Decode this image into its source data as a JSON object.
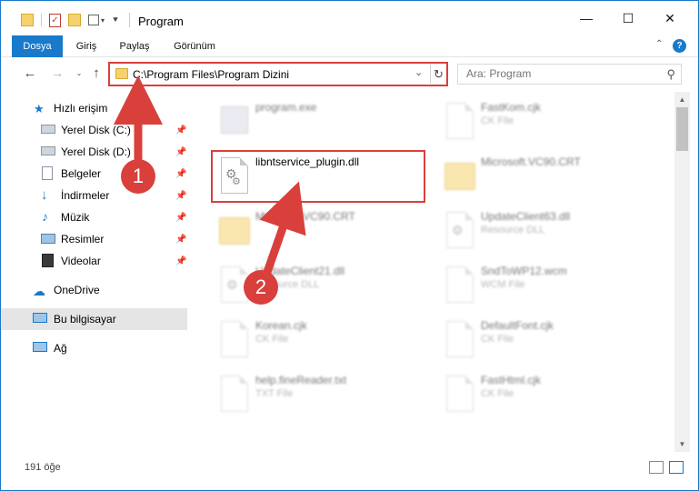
{
  "window": {
    "title": "Program",
    "minimize": "—",
    "maximize": "☐",
    "close": "✕"
  },
  "ribbon": {
    "tabs": [
      "Dosya",
      "Giriş",
      "Paylaş",
      "Görünüm"
    ],
    "collapse_icon": "chevron-up",
    "help": "?"
  },
  "address": {
    "path": "C:\\Program Files\\Program Dizini",
    "search_placeholder": "Ara: Program"
  },
  "nav": {
    "items": [
      {
        "label": "Hızlı erişim",
        "icon": "star-icon",
        "pinned": false
      },
      {
        "label": "Yerel Disk (C:)",
        "icon": "drive-icon",
        "pinned": true
      },
      {
        "label": "Yerel Disk (D:)",
        "icon": "drive-icon",
        "pinned": true
      },
      {
        "label": "Belgeler",
        "icon": "document-icon",
        "pinned": true
      },
      {
        "label": "İndirmeler",
        "icon": "download-icon",
        "pinned": true
      },
      {
        "label": "Müzik",
        "icon": "music-icon",
        "pinned": true
      },
      {
        "label": "Resimler",
        "icon": "pictures-icon",
        "pinned": true
      },
      {
        "label": "Videolar",
        "icon": "video-icon",
        "pinned": true
      },
      {
        "label": "OneDrive",
        "icon": "cloud-icon",
        "pinned": false
      },
      {
        "label": "Bu bilgisayar",
        "icon": "computer-icon",
        "pinned": false
      },
      {
        "label": "Ağ",
        "icon": "network-icon",
        "pinned": false
      }
    ]
  },
  "files": [
    {
      "name": "program.exe",
      "type": "",
      "icon": "exe"
    },
    {
      "name": "FastKom.cjk",
      "type": "CK File",
      "icon": "doc"
    },
    {
      "name": "libntservice_plugin.dll",
      "type": "",
      "icon": "dll"
    },
    {
      "name": "Microsoft.VC90.CRT",
      "type": "",
      "icon": "folder"
    },
    {
      "name": "Microsoft.VC90.CRT",
      "type": "",
      "icon": "folder"
    },
    {
      "name": "UpdateClient63.dll",
      "type": "Resource DLL",
      "icon": "dll"
    },
    {
      "name": "UpdateClient21.dll",
      "type": "Resource DLL",
      "icon": "dll"
    },
    {
      "name": "SndToWP12.wcm",
      "type": "WCM File",
      "icon": "doc"
    },
    {
      "name": "Korean.cjk",
      "type": "CK File",
      "icon": "doc"
    },
    {
      "name": "DefaultFont.cjk",
      "type": "CK File",
      "icon": "doc"
    },
    {
      "name": "help.fineReader.txt",
      "type": "TXT File",
      "icon": "doc"
    },
    {
      "name": "FastHtml.cjk",
      "type": "CK File",
      "icon": "doc"
    }
  ],
  "status": {
    "count": "191 öğe"
  },
  "annotations": {
    "badge1": "1",
    "badge2": "2",
    "color": "#d9403b"
  }
}
